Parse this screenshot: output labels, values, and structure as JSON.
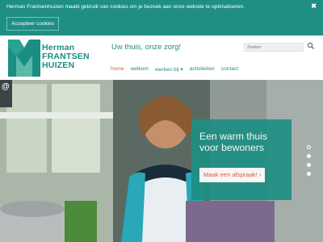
{
  "cookie_bar": {
    "message": "Herman Frantsenhuizen maakt gebruik van cookies om je bezoek aan onze website te optimaliseren.",
    "accept_label": "Accepteer cookies",
    "close_icon": "close-icon"
  },
  "header": {
    "logo_lines": [
      "Herman",
      "FRANTSEN",
      "HUIZEN"
    ],
    "tagline": "Uw thuis, onze zorg!",
    "search_placeholder": "Zoeken",
    "search_icon": "search-icon",
    "nav": [
      {
        "label": "home",
        "active": true
      },
      {
        "label": "welkom",
        "active": false
      },
      {
        "label": "werken bij ▾",
        "active": false
      },
      {
        "label": "activiteiten",
        "active": false
      },
      {
        "label": "contact",
        "active": false
      }
    ]
  },
  "hero": {
    "accessibility_label": "@",
    "promo_title": "Een warm thuis voor bewoners",
    "promo_button": "Maak een afspraak! ›",
    "slides": 4,
    "active_slide": 1
  },
  "colors": {
    "brand_teal": "#1f8f84",
    "accent_orange": "#e25a2c",
    "logo_grey": "#6f7477"
  }
}
